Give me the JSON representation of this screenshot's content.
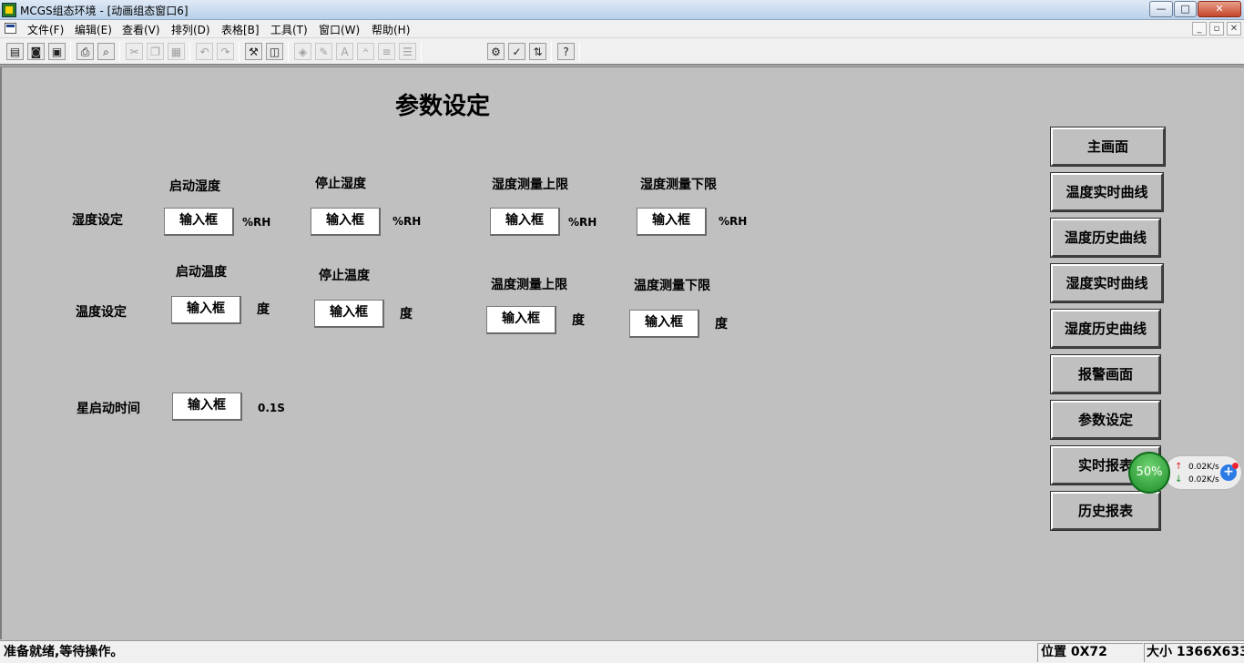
{
  "window": {
    "title": "MCGS组态环境 - [动画组态窗口6]"
  },
  "menu": {
    "items": [
      "文件(F)",
      "编辑(E)",
      "查看(V)",
      "排列(D)",
      "表格[B]",
      "工具(T)",
      "窗口(W)",
      "帮助(H)"
    ]
  },
  "page": {
    "title": "参数设定"
  },
  "humidity": {
    "row_label": "湿度设定",
    "start_label": "启动湿度",
    "stop_label": "停止湿度",
    "upper_label": "湿度测量上限",
    "lower_label": "湿度测量下限",
    "unit": "%RH"
  },
  "temperature": {
    "row_label": "温度设定",
    "start_label": "启动温度",
    "stop_label": "停止温度",
    "upper_label": "温度测量上限",
    "lower_label": "温度测量下限",
    "unit": "度"
  },
  "star": {
    "label": "星启动时间",
    "unit": "0.1S"
  },
  "input_placeholder": "输入框",
  "nav": [
    "主画面",
    "温度实时曲线",
    "温度历史曲线",
    "湿度实时曲线",
    "湿度历史曲线",
    "报警画面",
    "参数设定",
    "实时报表",
    "历史报表"
  ],
  "status": {
    "message": "准备就绪,等待操作。",
    "position": "位置 0X72",
    "size": "大小 1366X633"
  },
  "net_widget": {
    "percent": "50%",
    "up": "0.02K/s",
    "down": "0.02K/s"
  },
  "colors": {
    "canvas": "#c0c0c0",
    "titlebar": "#dfe9f5"
  }
}
